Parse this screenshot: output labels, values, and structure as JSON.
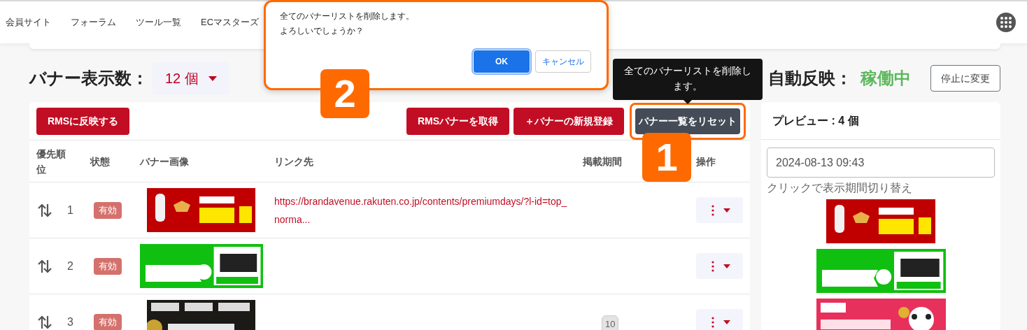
{
  "nav": {
    "items": [
      "会員サイト",
      "フォーラム",
      "ツール一覧",
      "ECマスターズ"
    ]
  },
  "banner_count": {
    "label": "バナー表示数：",
    "value": "12 個"
  },
  "auto_sync": {
    "label": "自動反映：",
    "status": "稼働中",
    "button": "停止に変更"
  },
  "toolbar": {
    "left_button": "RMSに反映する",
    "buttons": [
      "RMSバナーを取得",
      "＋バナーの新規登録",
      "バナー一覧をリセット"
    ]
  },
  "table": {
    "columns": [
      "優先順位",
      "状態",
      "バナー画像",
      "リンク先",
      "掲載期間",
      "操作"
    ],
    "rows": [
      {
        "priority": "1",
        "status": "有効",
        "link": "https://brandavenue.rakuten.co.jp/contents/premiumdays/?l-id=top_norma..."
      },
      {
        "priority": "2",
        "status": "有効"
      },
      {
        "priority": "3",
        "status": "有効",
        "period": "10"
      }
    ]
  },
  "preview": {
    "title": "プレビュー : 4 個",
    "date": "2024-08-13 09:43",
    "hint": "クリックで表示期間切り替え"
  },
  "tooltip": "全てのバナーリストを削除します。",
  "dialog": {
    "message": [
      "全てのバナーリストを削除します。",
      "よろしいでしょうか？"
    ],
    "buttons": [
      {
        "label": "OK",
        "kind": "primary"
      },
      {
        "label": "キャンセル",
        "kind": "secondary"
      }
    ]
  },
  "annotations": [
    "1",
    "2"
  ]
}
